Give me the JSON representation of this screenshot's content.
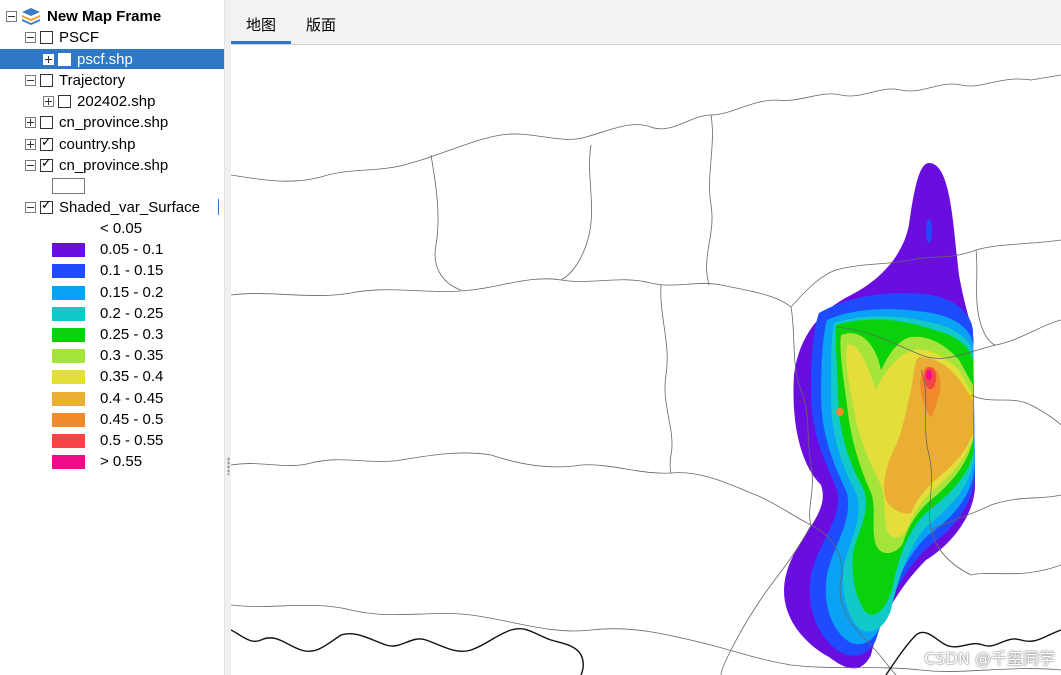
{
  "toc": {
    "map_frame": "New Map Frame",
    "pscf_group": "PSCF",
    "pscf_layer": "pscf.shp",
    "trajectory_group": "Trajectory",
    "trajectory_layer": "202402.shp",
    "cn_province_1": "cn_province.shp",
    "country": "country.shp",
    "cn_province_2": "cn_province.shp",
    "shaded": "Shaded_var_Surface"
  },
  "legend": {
    "items": [
      {
        "label": "< 0.05",
        "color": "#ffffff"
      },
      {
        "label": "0.05 - 0.1",
        "color": "#6a0ee0"
      },
      {
        "label": "0.1 - 0.15",
        "color": "#1f4bff"
      },
      {
        "label": "0.15 - 0.2",
        "color": "#0aa2f5"
      },
      {
        "label": "0.2 - 0.25",
        "color": "#12c9c9"
      },
      {
        "label": "0.25 - 0.3",
        "color": "#0ad20a"
      },
      {
        "label": "0.3 - 0.35",
        "color": "#a5e43a"
      },
      {
        "label": "0.35 - 0.4",
        "color": "#e4de3a"
      },
      {
        "label": "0.4 - 0.45",
        "color": "#e9ae33"
      },
      {
        "label": "0.45 - 0.5",
        "color": "#f08a2c"
      },
      {
        "label": "0.5 - 0.55",
        "color": "#f74444"
      },
      {
        "label": "> 0.55",
        "color": "#ef0c88"
      }
    ]
  },
  "tabs": {
    "map": "地图",
    "layout": "版面"
  },
  "watermark": "CSDN @千玺同学"
}
